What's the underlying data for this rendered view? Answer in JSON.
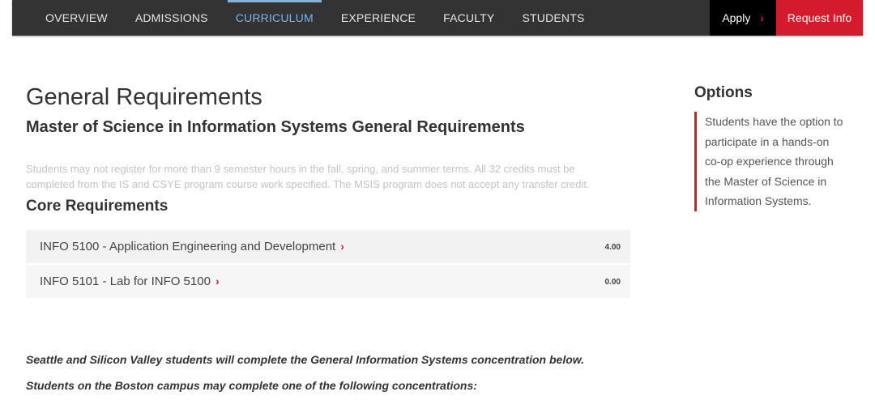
{
  "nav": {
    "items": [
      {
        "label": "OVERVIEW",
        "active": false
      },
      {
        "label": "ADMISSIONS",
        "active": false
      },
      {
        "label": "CURRICULUM",
        "active": true
      },
      {
        "label": "EXPERIENCE",
        "active": false
      },
      {
        "label": "FACULTY",
        "active": false
      },
      {
        "label": "STUDENTS",
        "active": false
      }
    ],
    "apply_label": "Apply",
    "apply_chevron": "›",
    "request_label": "Request Info"
  },
  "colors": {
    "nav_bg": "#333333",
    "active_accent": "#7fb3e0",
    "brand_red": "#d41b2c",
    "apply_bg": "#000000"
  },
  "main": {
    "title": "General Requirements",
    "subtitle": "Master of Science in Information Systems General Requirements",
    "intro": "Students may not register for more than 9 semester hours in the fall, spring, and summer terms. All 32 credits must be completed from the IS and CSYE program course work specified. The MSIS program does not accept any transfer credit.",
    "core_title": "Core Requirements",
    "courses": [
      {
        "name": "INFO 5100 - Application Engineering and Development",
        "credits": "4.00"
      },
      {
        "name": "INFO 5101 - Lab for INFO 5100",
        "credits": "0.00"
      }
    ],
    "course_chevron": "›",
    "note_seattle": "Seattle and Silicon Valley students will complete the General Information Systems concentration below.",
    "note_boston": "Students on the Boston campus may complete one of the following concentrations:"
  },
  "sidebar": {
    "title": "Options",
    "text": "Students have the option to participate in a hands-on co-op experience through the Master of Science in Information Systems."
  }
}
